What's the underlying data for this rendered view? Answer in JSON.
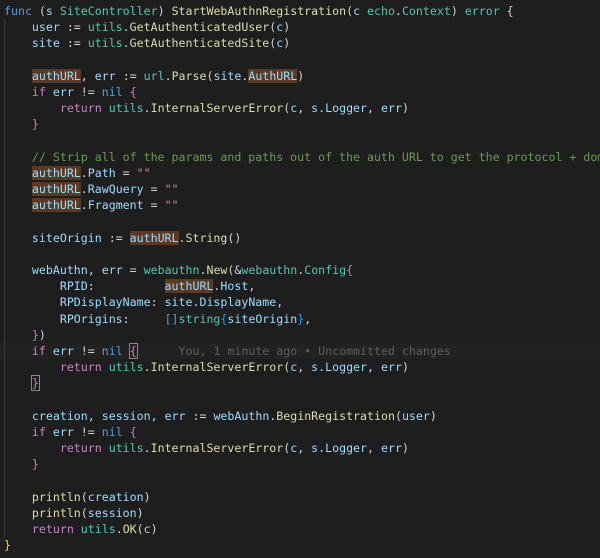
{
  "lines": [
    [
      [
        "kw",
        "func"
      ],
      [
        "op",
        " ("
      ],
      [
        "var",
        "s"
      ],
      [
        "op",
        " "
      ],
      [
        "type",
        "SiteController"
      ],
      [
        "op",
        ") "
      ],
      [
        "fn",
        "StartWebAuthnRegistration"
      ],
      [
        "op",
        "("
      ],
      [
        "var",
        "c"
      ],
      [
        "op",
        " "
      ],
      [
        "type",
        "echo"
      ],
      [
        "op",
        "."
      ],
      [
        "type",
        "Context"
      ],
      [
        "op",
        ") "
      ],
      [
        "type",
        "error"
      ],
      [
        "op",
        " {"
      ]
    ],
    [
      [
        "op",
        "    "
      ],
      [
        "var",
        "user"
      ],
      [
        "op",
        " := "
      ],
      [
        "type",
        "utils"
      ],
      [
        "op",
        "."
      ],
      [
        "fn",
        "GetAuthenticatedUser"
      ],
      [
        "op",
        "("
      ],
      [
        "var",
        "c"
      ],
      [
        "op",
        ")"
      ]
    ],
    [
      [
        "op",
        "    "
      ],
      [
        "var",
        "site"
      ],
      [
        "op",
        " := "
      ],
      [
        "type",
        "utils"
      ],
      [
        "op",
        "."
      ],
      [
        "fn",
        "GetAuthenticatedSite"
      ],
      [
        "op",
        "("
      ],
      [
        "var",
        "c"
      ],
      [
        "op",
        ")"
      ]
    ],
    [],
    [
      [
        "op",
        "    "
      ],
      [
        "var hl",
        "authURL"
      ],
      [
        "op",
        ", "
      ],
      [
        "var",
        "err"
      ],
      [
        "op",
        " := "
      ],
      [
        "type",
        "url"
      ],
      [
        "op",
        "."
      ],
      [
        "fn",
        "Parse"
      ],
      [
        "op",
        "("
      ],
      [
        "var",
        "site"
      ],
      [
        "op",
        "."
      ],
      [
        "var hl",
        "AuthURL"
      ],
      [
        "op",
        ")"
      ]
    ],
    [
      [
        "op",
        "    "
      ],
      [
        "ctrl",
        "if"
      ],
      [
        "op",
        " "
      ],
      [
        "var",
        "err"
      ],
      [
        "op",
        " != "
      ],
      [
        "kw",
        "nil"
      ],
      [
        "op",
        " "
      ],
      [
        "br2",
        "{"
      ]
    ],
    [
      [
        "op",
        "        "
      ],
      [
        "ctrl",
        "return"
      ],
      [
        "op",
        " "
      ],
      [
        "type",
        "utils"
      ],
      [
        "op",
        "."
      ],
      [
        "fn",
        "InternalServerError"
      ],
      [
        "op",
        "("
      ],
      [
        "var",
        "c"
      ],
      [
        "op",
        ", "
      ],
      [
        "var",
        "s"
      ],
      [
        "op",
        "."
      ],
      [
        "var",
        "Logger"
      ],
      [
        "op",
        ", "
      ],
      [
        "var",
        "err"
      ],
      [
        "op",
        ")"
      ]
    ],
    [
      [
        "op",
        "    "
      ],
      [
        "br2",
        "}"
      ]
    ],
    [],
    [
      [
        "op",
        "    "
      ],
      [
        "cm",
        "// Strip all of the params and paths out of the auth URL to get the protocol + domain"
      ]
    ],
    [
      [
        "op",
        "    "
      ],
      [
        "var hl",
        "authURL"
      ],
      [
        "op",
        "."
      ],
      [
        "var",
        "Path"
      ],
      [
        "op",
        " = "
      ],
      [
        "str",
        "\"\""
      ]
    ],
    [
      [
        "op",
        "    "
      ],
      [
        "var hl",
        "authURL"
      ],
      [
        "op",
        "."
      ],
      [
        "var",
        "RawQuery"
      ],
      [
        "op",
        " = "
      ],
      [
        "str",
        "\"\""
      ]
    ],
    [
      [
        "op",
        "    "
      ],
      [
        "var hl",
        "authURL"
      ],
      [
        "op",
        "."
      ],
      [
        "var",
        "Fragment"
      ],
      [
        "op",
        " = "
      ],
      [
        "str",
        "\"\""
      ]
    ],
    [],
    [
      [
        "op",
        "    "
      ],
      [
        "var",
        "siteOrigin"
      ],
      [
        "op",
        " := "
      ],
      [
        "var hl",
        "authURL"
      ],
      [
        "op",
        "."
      ],
      [
        "fn",
        "String"
      ],
      [
        "op",
        "()"
      ]
    ],
    [],
    [
      [
        "op",
        "    "
      ],
      [
        "var",
        "webAuthn"
      ],
      [
        "op",
        ", "
      ],
      [
        "var",
        "err"
      ],
      [
        "op",
        " = "
      ],
      [
        "type",
        "webauthn"
      ],
      [
        "op",
        "."
      ],
      [
        "fn",
        "New"
      ],
      [
        "op",
        "(&"
      ],
      [
        "type",
        "webauthn"
      ],
      [
        "op",
        "."
      ],
      [
        "type",
        "Config"
      ],
      [
        "br2",
        "{"
      ]
    ],
    [
      [
        "op",
        "        "
      ],
      [
        "var",
        "RPID"
      ],
      [
        "op",
        ":          "
      ],
      [
        "var hl",
        "authURL"
      ],
      [
        "op",
        "."
      ],
      [
        "var",
        "Host"
      ],
      [
        "op",
        ","
      ]
    ],
    [
      [
        "op",
        "        "
      ],
      [
        "var",
        "RPDisplayName"
      ],
      [
        "op",
        ": "
      ],
      [
        "var",
        "site"
      ],
      [
        "op",
        "."
      ],
      [
        "var",
        "DisplayName"
      ],
      [
        "op",
        ","
      ]
    ],
    [
      [
        "op",
        "        "
      ],
      [
        "var",
        "RPOrigins"
      ],
      [
        "op",
        ":     "
      ],
      [
        "kw",
        "[]"
      ],
      [
        "type",
        "string"
      ],
      [
        "br3",
        "{"
      ],
      [
        "var",
        "siteOrigin"
      ],
      [
        "br3",
        "}"
      ],
      [
        "op",
        ","
      ]
    ],
    [
      [
        "op",
        "    "
      ],
      [
        "br2",
        "}"
      ],
      [
        "op",
        ")"
      ]
    ],
    [
      [
        "op",
        "    "
      ],
      [
        "ctrl",
        "if"
      ],
      [
        "op",
        " "
      ],
      [
        "var",
        "err"
      ],
      [
        "op",
        " != "
      ],
      [
        "kw",
        "nil"
      ],
      [
        "op",
        " "
      ],
      [
        "br2 bracket-box",
        "{"
      ],
      [
        "blame",
        "      You, 1 minute ago • Uncommitted changes"
      ]
    ],
    [
      [
        "op",
        "        "
      ],
      [
        "ctrl",
        "return"
      ],
      [
        "op",
        " "
      ],
      [
        "type",
        "utils"
      ],
      [
        "op",
        "."
      ],
      [
        "fn",
        "InternalServerError"
      ],
      [
        "op",
        "("
      ],
      [
        "var",
        "c"
      ],
      [
        "op",
        ", "
      ],
      [
        "var",
        "s"
      ],
      [
        "op",
        "."
      ],
      [
        "var",
        "Logger"
      ],
      [
        "op",
        ", "
      ],
      [
        "var",
        "err"
      ],
      [
        "op",
        ")"
      ]
    ],
    [
      [
        "op",
        "    "
      ],
      [
        "br2 bracket-box",
        "}"
      ]
    ],
    [],
    [
      [
        "op",
        "    "
      ],
      [
        "var",
        "creation"
      ],
      [
        "op",
        ", "
      ],
      [
        "var",
        "session"
      ],
      [
        "op",
        ", "
      ],
      [
        "var",
        "err"
      ],
      [
        "op",
        " := "
      ],
      [
        "var",
        "webAuthn"
      ],
      [
        "op",
        "."
      ],
      [
        "fn",
        "BeginRegistration"
      ],
      [
        "op",
        "("
      ],
      [
        "var",
        "user"
      ],
      [
        "op",
        ")"
      ]
    ],
    [
      [
        "op",
        "    "
      ],
      [
        "ctrl",
        "if"
      ],
      [
        "op",
        " "
      ],
      [
        "var",
        "err"
      ],
      [
        "op",
        " != "
      ],
      [
        "kw",
        "nil"
      ],
      [
        "op",
        " "
      ],
      [
        "br2",
        "{"
      ]
    ],
    [
      [
        "op",
        "        "
      ],
      [
        "ctrl",
        "return"
      ],
      [
        "op",
        " "
      ],
      [
        "type",
        "utils"
      ],
      [
        "op",
        "."
      ],
      [
        "fn",
        "InternalServerError"
      ],
      [
        "op",
        "("
      ],
      [
        "var",
        "c"
      ],
      [
        "op",
        ", "
      ],
      [
        "var",
        "s"
      ],
      [
        "op",
        "."
      ],
      [
        "var",
        "Logger"
      ],
      [
        "op",
        ", "
      ],
      [
        "var",
        "err"
      ],
      [
        "op",
        ")"
      ]
    ],
    [
      [
        "op",
        "    "
      ],
      [
        "br2",
        "}"
      ]
    ],
    [],
    [
      [
        "op",
        "    "
      ],
      [
        "fn",
        "println"
      ],
      [
        "op",
        "("
      ],
      [
        "var",
        "creation"
      ],
      [
        "op",
        ")"
      ]
    ],
    [
      [
        "op",
        "    "
      ],
      [
        "fn",
        "println"
      ],
      [
        "op",
        "("
      ],
      [
        "var",
        "session"
      ],
      [
        "op",
        ")"
      ]
    ],
    [
      [
        "op",
        "    "
      ],
      [
        "ctrl",
        "return"
      ],
      [
        "op",
        " "
      ],
      [
        "type",
        "utils"
      ],
      [
        "op",
        "."
      ],
      [
        "fn",
        "OK"
      ],
      [
        "op",
        "("
      ],
      [
        "var",
        "c"
      ],
      [
        "op",
        ")"
      ]
    ],
    [
      [
        "br1",
        "}"
      ]
    ]
  ],
  "active_line": 21,
  "colors": {
    "background": "#1e1e1e",
    "keyword": "#569cd6",
    "control": "#c586c0",
    "function": "#dcdcaa",
    "type": "#4ec9b0",
    "variable": "#9cdcfe",
    "string": "#ce9178",
    "comment": "#6a9955",
    "highlight": "#5a3a25"
  }
}
